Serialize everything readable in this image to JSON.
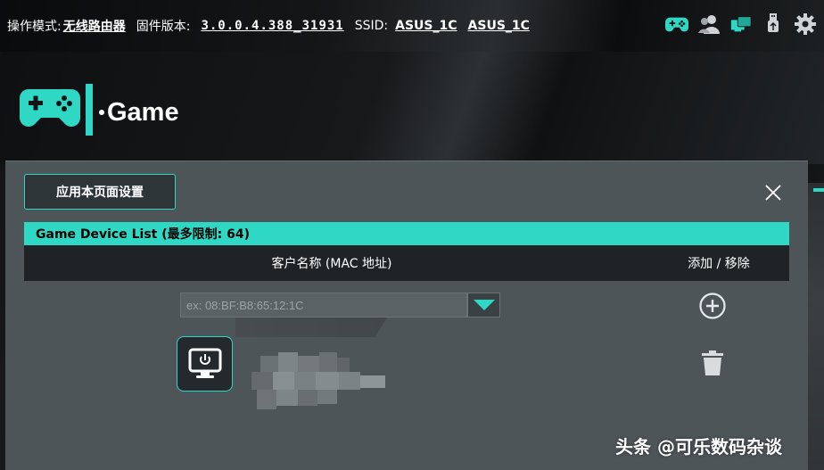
{
  "topbar": {
    "mode_label": "操作模式:",
    "mode_value": "无线路由器",
    "firmware_label": "固件版本:",
    "firmware_value": "3.0.0.4.388_31931",
    "ssid_label": "SSID:",
    "ssid_1": "ASUS_1C",
    "ssid_2": "ASUS_1C",
    "icons": [
      "gamepad-icon",
      "users-icon",
      "network-icon",
      "usb-icon",
      "gear-icon"
    ]
  },
  "hero": {
    "title": "Game"
  },
  "panel": {
    "apply_label": "应用本页面设置",
    "list_title": "Game Device List (最多限制:  64)",
    "col_client": "客户名称 (MAC 地址)",
    "col_action": "添加 / 移除",
    "mac_placeholder": "ex: 08:BF:B8:65:12:1C"
  },
  "watermark": "头条 @可乐数码杂谈",
  "colors": {
    "accent": "#2fd8c4",
    "panel_bg": "#4e5559",
    "header_bg": "#1f2326"
  }
}
